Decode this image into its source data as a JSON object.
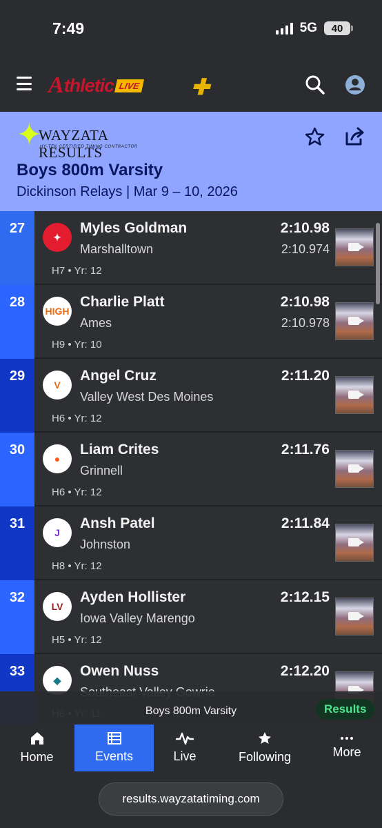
{
  "status": {
    "time": "7:49",
    "network": "5G",
    "battery": "40"
  },
  "header": {
    "brand_a": "A",
    "brand_word": "thletic",
    "brand_live": "LIVE"
  },
  "event": {
    "logo_title": "WAYZATA RESULTS",
    "logo_subtitle": "HY-TEK CERTIFIED TIMING CONTRACTOR",
    "title": "Boys 800m Varsity",
    "subtitle": "Dickinson Relays | Mar 9 – 10, 2026"
  },
  "results": [
    {
      "place": "27",
      "name": "Myles Goldman",
      "school": "Marshalltown",
      "heat": "H7",
      "year": "Yr: 12",
      "mark": "2:10.98",
      "detail": "2:10.974",
      "logo_text": "✦",
      "place_bg": "#2f6bf0",
      "logo_bg": "#e31c2f",
      "logo_fg": "#ffffff"
    },
    {
      "place": "28",
      "name": "Charlie Platt",
      "school": "Ames",
      "heat": "H9",
      "year": "Yr: 10",
      "mark": "2:10.98",
      "detail": "2:10.978",
      "logo_text": "HIGH",
      "place_bg": "#2b64ff",
      "logo_bg": "#ffffff",
      "logo_fg": "#e86d14"
    },
    {
      "place": "29",
      "name": "Angel Cruz",
      "school": "Valley West Des Moines",
      "heat": "H6",
      "year": "Yr: 12",
      "mark": "2:11.20",
      "detail": "",
      "logo_text": "V",
      "place_bg": "#0f36c4",
      "logo_bg": "#ffffff",
      "logo_fg": "#e36d1d"
    },
    {
      "place": "30",
      "name": "Liam Crites",
      "school": "Grinnell",
      "heat": "H6",
      "year": "Yr: 12",
      "mark": "2:11.76",
      "detail": "",
      "logo_text": "●",
      "place_bg": "#2b64ff",
      "logo_bg": "#ffffff",
      "logo_fg": "#ff5b20"
    },
    {
      "place": "31",
      "name": "Ansh Patel",
      "school": "Johnston",
      "heat": "H8",
      "year": "Yr: 12",
      "mark": "2:11.84",
      "detail": "",
      "logo_text": "J",
      "place_bg": "#0f36c4",
      "logo_bg": "#ffffff",
      "logo_fg": "#7b2fd2"
    },
    {
      "place": "32",
      "name": "Ayden Hollister",
      "school": "Iowa Valley Marengo",
      "heat": "H5",
      "year": "Yr: 12",
      "mark": "2:12.15",
      "detail": "",
      "logo_text": "LV",
      "place_bg": "#2b64ff",
      "logo_bg": "#ffffff",
      "logo_fg": "#9b1f1f"
    },
    {
      "place": "33",
      "name": "Owen Nuss",
      "school": "Southeast Valley Gowrie",
      "heat": "H8",
      "year": "Yr: 11",
      "mark": "2:12.20",
      "detail": "",
      "logo_text": "◆",
      "place_bg": "#0f36c4",
      "logo_bg": "#ffffff",
      "logo_fg": "#177a88"
    }
  ],
  "bottom_event": {
    "label": "Boys 800m Varsity",
    "results_button": "Results"
  },
  "tabs": [
    {
      "label": "Home",
      "icon": "home-icon"
    },
    {
      "label": "Events",
      "icon": "events-icon"
    },
    {
      "label": "Live",
      "icon": "live-icon"
    },
    {
      "label": "Following",
      "icon": "star-icon"
    },
    {
      "label": "More",
      "icon": "more-icon"
    }
  ],
  "browser": {
    "url": "results.wayzatatiming.com"
  },
  "colors": {
    "accent": "#2f6bf0",
    "banner": "#8fa5ff",
    "results_green": "#4ce48c"
  }
}
